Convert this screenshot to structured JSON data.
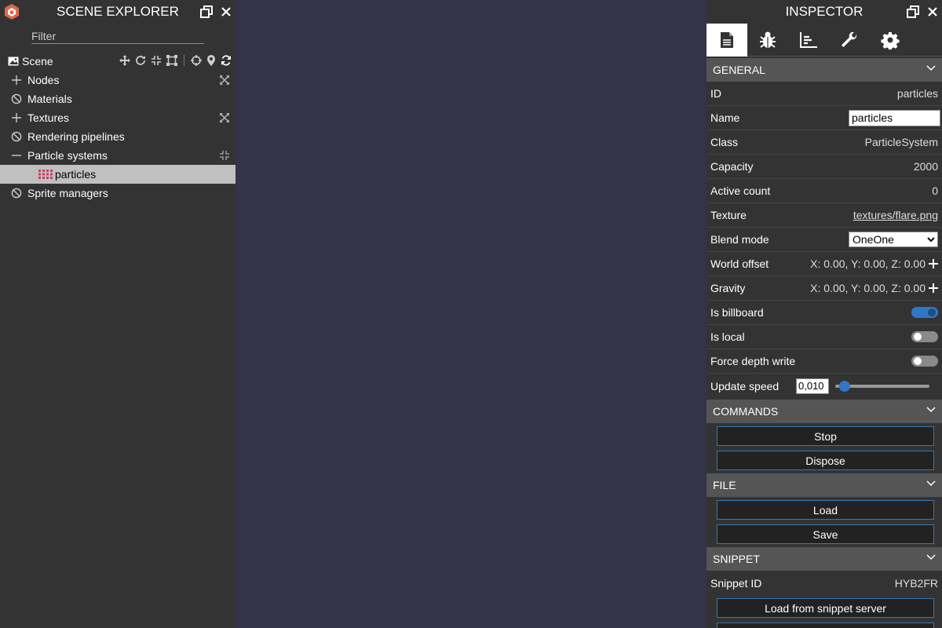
{
  "explorer": {
    "title": "SCENE EXPLORER",
    "filter_placeholder": "Filter",
    "scene_label": "Scene",
    "items": [
      {
        "label": "Nodes",
        "icon": "plus-icon",
        "right": "expand-icon"
      },
      {
        "label": "Materials",
        "icon": "ban-icon"
      },
      {
        "label": "Textures",
        "icon": "plus-icon",
        "right": "expand-icon"
      },
      {
        "label": "Rendering pipelines",
        "icon": "ban-icon"
      },
      {
        "label": "Particle systems",
        "icon": "minus-icon",
        "right": "compress-icon"
      },
      {
        "label": "particles",
        "icon": "particles-icon",
        "selected": true
      },
      {
        "label": "Sprite managers",
        "icon": "ban-icon"
      }
    ]
  },
  "inspector": {
    "title": "INSPECTOR",
    "tabs": [
      "file-icon",
      "bug-icon",
      "chart-icon",
      "wrench-icon",
      "gear-icon"
    ],
    "general": {
      "header": "GENERAL",
      "id_label": "ID",
      "id_value": "particles",
      "name_label": "Name",
      "name_value": "particles",
      "class_label": "Class",
      "class_value": "ParticleSystem",
      "capacity_label": "Capacity",
      "capacity_value": "2000",
      "active_label": "Active count",
      "active_value": "0",
      "texture_label": "Texture",
      "texture_value": "textures/flare.png",
      "blend_label": "Blend mode",
      "blend_value": "OneOne",
      "world_offset_label": "World offset",
      "world_offset_value": "X: 0.00, Y: 0.00, Z: 0.00",
      "gravity_label": "Gravity",
      "gravity_value": "X: 0.00, Y: 0.00, Z: 0.00",
      "billboard_label": "Is billboard",
      "billboard_on": true,
      "local_label": "Is local",
      "local_on": false,
      "depth_label": "Force depth write",
      "depth_on": false,
      "speed_label": "Update speed",
      "speed_value": "0,010",
      "speed_fraction": 0.1
    },
    "commands": {
      "header": "COMMANDS",
      "stop": "Stop",
      "dispose": "Dispose"
    },
    "file": {
      "header": "FILE",
      "load": "Load",
      "save": "Save"
    },
    "snippet": {
      "header": "SNIPPET",
      "id_label": "Snippet ID",
      "id_value": "HYB2FR",
      "load_server": "Load from snippet server"
    }
  },
  "colors": {
    "viewport": "#33334c",
    "panel": "#333333",
    "section": "#555555",
    "accent": "#2f78c4",
    "logo": "#e0684b"
  }
}
